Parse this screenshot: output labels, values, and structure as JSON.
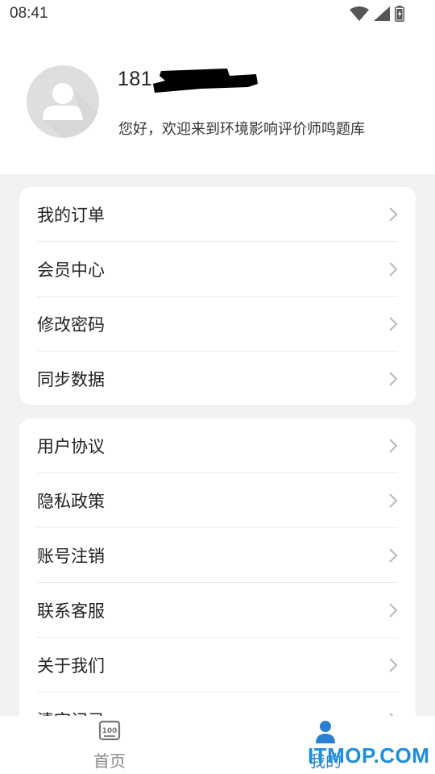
{
  "status_bar": {
    "time": "08:41",
    "icons": [
      "wifi-icon",
      "cell-signal-icon",
      "battery-charging-icon"
    ]
  },
  "profile": {
    "username": "181",
    "greeting": "您好，欢迎来到环境影响评价师鸣题库"
  },
  "menu_group_1": [
    {
      "label": "我的订单"
    },
    {
      "label": "会员中心"
    },
    {
      "label": "修改密码"
    },
    {
      "label": "同步数据"
    }
  ],
  "menu_group_2": [
    {
      "label": "用户协议"
    },
    {
      "label": "隐私政策"
    },
    {
      "label": "账号注销"
    },
    {
      "label": "联系客服"
    },
    {
      "label": "关于我们"
    },
    {
      "label": "清空记录"
    }
  ],
  "bottom_nav": {
    "home_label": "首页",
    "mine_label": "我的",
    "active": "mine"
  },
  "watermark": "ITMOP.COM",
  "colors": {
    "accent": "#2a7fd4",
    "background": "#f2f2f2",
    "card": "#ffffff",
    "watermark": "#1c8ee0"
  }
}
